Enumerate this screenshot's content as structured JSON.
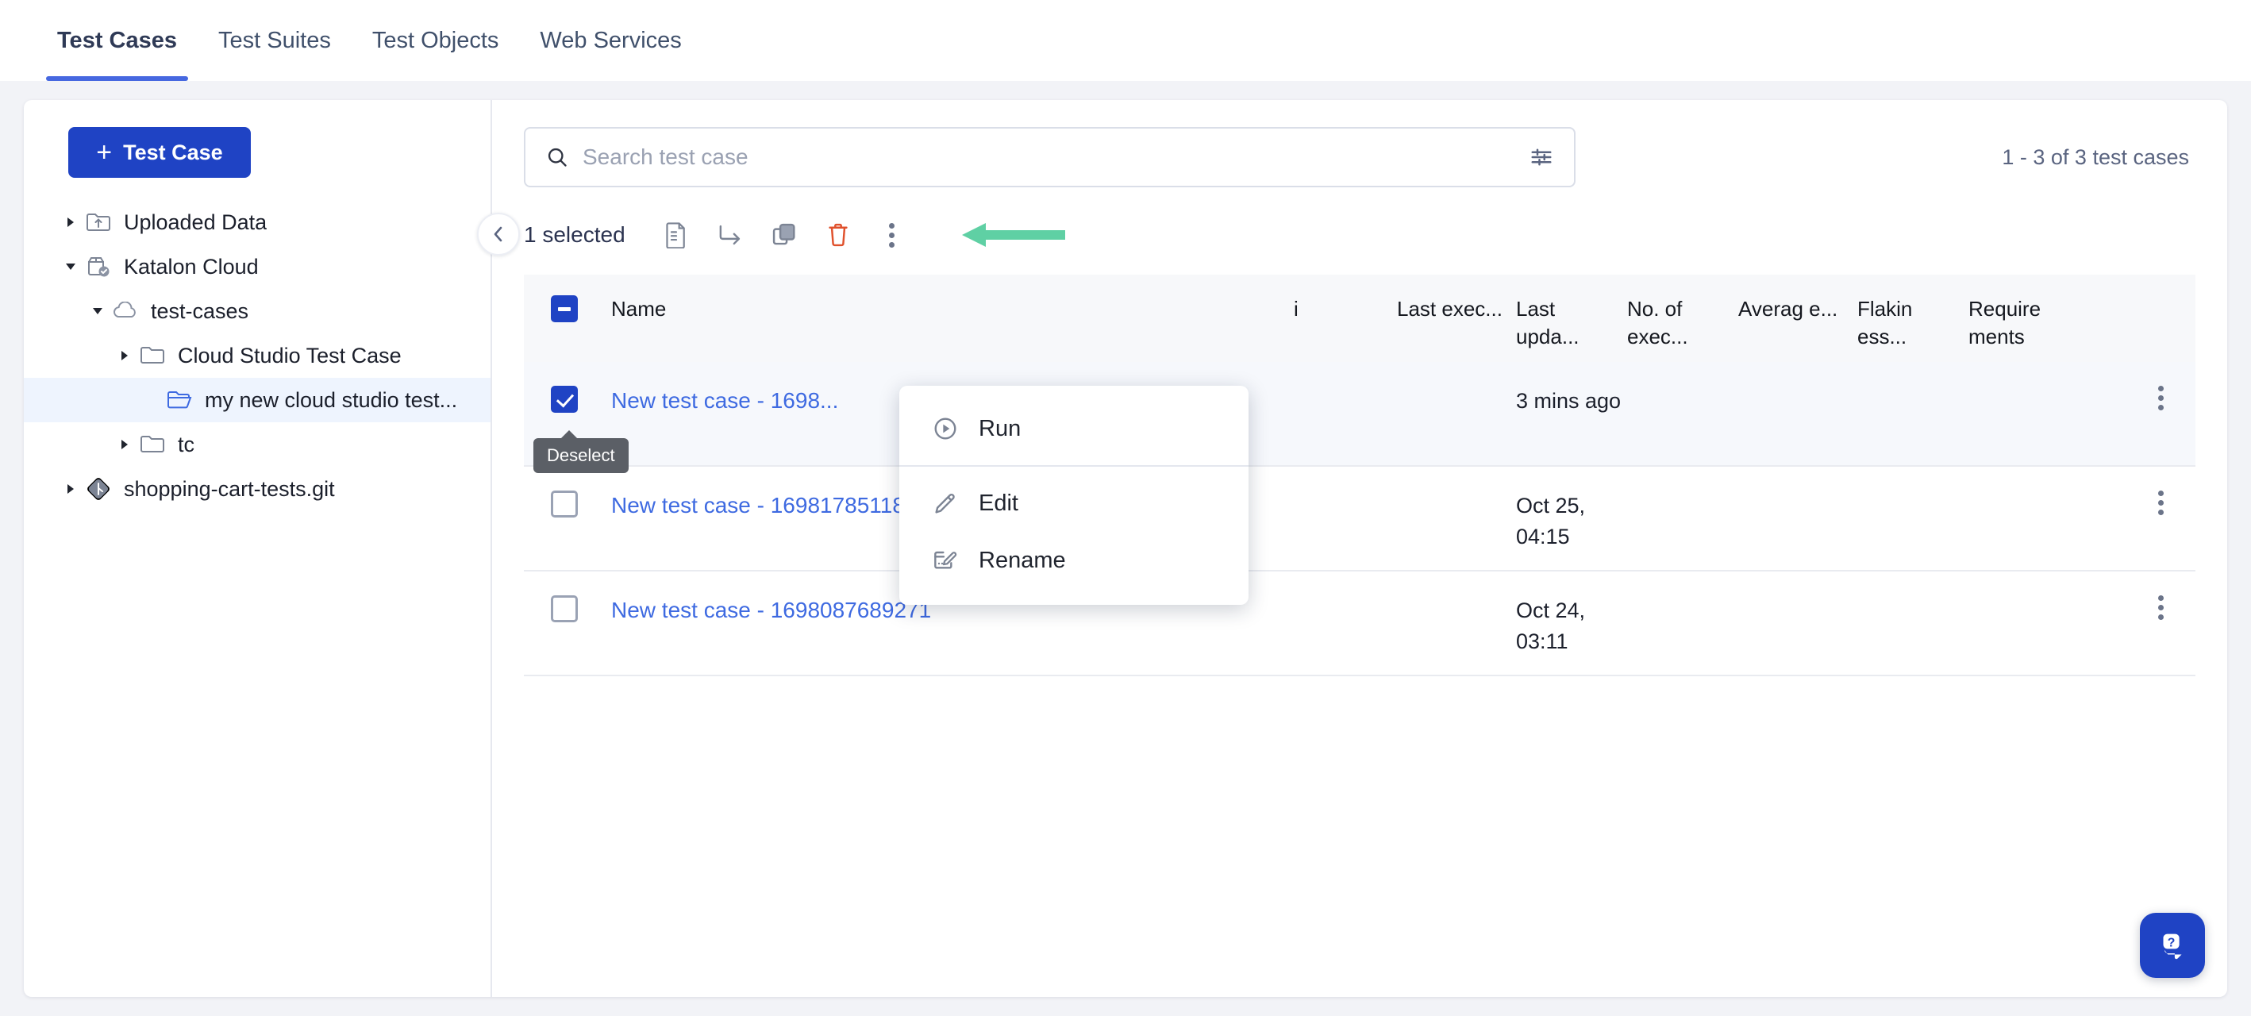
{
  "tabs": [
    {
      "label": "Test Cases",
      "active": true
    },
    {
      "label": "Test Suites",
      "active": false
    },
    {
      "label": "Test Objects",
      "active": false
    },
    {
      "label": "Web Services",
      "active": false
    }
  ],
  "sidebar": {
    "new_button_label": "Test Case",
    "new_button_plus": "+",
    "tree": [
      {
        "label": "Uploaded Data",
        "icon": "folder-upload-icon",
        "caret": "right",
        "indent": 0,
        "selected": false
      },
      {
        "label": "Katalon Cloud",
        "icon": "cloud-package-check-icon",
        "caret": "down",
        "indent": 0,
        "selected": false
      },
      {
        "label": "test-cases",
        "icon": "cloud-icon",
        "caret": "down",
        "indent": 1,
        "selected": false
      },
      {
        "label": "Cloud Studio Test Case",
        "icon": "folder-icon",
        "caret": "right",
        "indent": 2,
        "selected": false
      },
      {
        "label": "my new cloud studio test...",
        "icon": "folder-open-icon",
        "caret": "none",
        "indent": 3,
        "selected": true
      },
      {
        "label": "tc",
        "icon": "folder-icon",
        "caret": "right",
        "indent": 2,
        "selected": false
      },
      {
        "label": "shopping-cart-tests.git",
        "icon": "git-icon",
        "caret": "right",
        "indent": 0,
        "selected": false
      }
    ]
  },
  "search": {
    "placeholder": "Search test case",
    "value": "",
    "icon": "search-icon",
    "filter_icon": "filter-sliders-icon"
  },
  "pagination": {
    "count_text": "1 - 3 of 3 test cases"
  },
  "toolbar": {
    "selected_text": "1 selected",
    "collapse_icon": "chevron-left-icon",
    "actions": [
      {
        "name": "script-file-icon",
        "title": "Script"
      },
      {
        "name": "move-icon",
        "title": "Move"
      },
      {
        "name": "duplicate-icon",
        "title": "Duplicate"
      },
      {
        "name": "delete-icon",
        "title": "Delete"
      },
      {
        "name": "more-options-icon",
        "title": "More"
      }
    ]
  },
  "context_menu": {
    "items": [
      {
        "label": "Run",
        "icon": "play-circle-icon",
        "divider_after": true
      },
      {
        "label": "Edit",
        "icon": "pencil-icon",
        "divider_after": false
      },
      {
        "label": "Rename",
        "icon": "rename-icon",
        "divider_after": false
      }
    ]
  },
  "tooltip": {
    "text": "Deselect"
  },
  "table": {
    "header_checkbox_state": "indeterminate",
    "columns": [
      {
        "key": "name",
        "label": "Name"
      },
      {
        "key": "path",
        "label": ""
      },
      {
        "key": "ext",
        "label": "i"
      },
      {
        "key": "last_exec",
        "label": "Last exec..."
      },
      {
        "key": "last_upd",
        "label": "Last upda..."
      },
      {
        "key": "no_exec",
        "label": "No. of exec..."
      },
      {
        "key": "average",
        "label": "Averag e..."
      },
      {
        "key": "flakiness",
        "label": "Flakin ess..."
      },
      {
        "key": "requirements",
        "label": "Require ments"
      }
    ],
    "rows": [
      {
        "checked": true,
        "name": "New test case - 1698...",
        "last_exec": "",
        "last_upd": "3 mins ago",
        "no_exec": "",
        "average": "",
        "flakiness": "",
        "requirements": "",
        "kebab": "row-more-icon"
      },
      {
        "checked": false,
        "name": "New test case - 1698178511896",
        "last_exec": "",
        "last_upd": "Oct 25, 04:15",
        "no_exec": "",
        "average": "",
        "flakiness": "",
        "requirements": "",
        "kebab": "row-more-icon"
      },
      {
        "checked": false,
        "name": "New test case - 1698087689271",
        "last_exec": "",
        "last_upd": "Oct 24, 03:11",
        "no_exec": "",
        "average": "",
        "flakiness": "",
        "requirements": "",
        "kebab": "row-more-icon"
      }
    ]
  },
  "annotation": {
    "arrow_color": "#5fd0a4",
    "direction": "left"
  },
  "help_widget": {
    "icon": "help-chat-icon"
  },
  "colors": {
    "accent": "#1f43c4",
    "tab_active": "#4668e0",
    "link": "#3e6ae1",
    "delete": "#e0512c",
    "selected_row": "#f6f8fc",
    "tree_selected": "#eef4fe"
  }
}
